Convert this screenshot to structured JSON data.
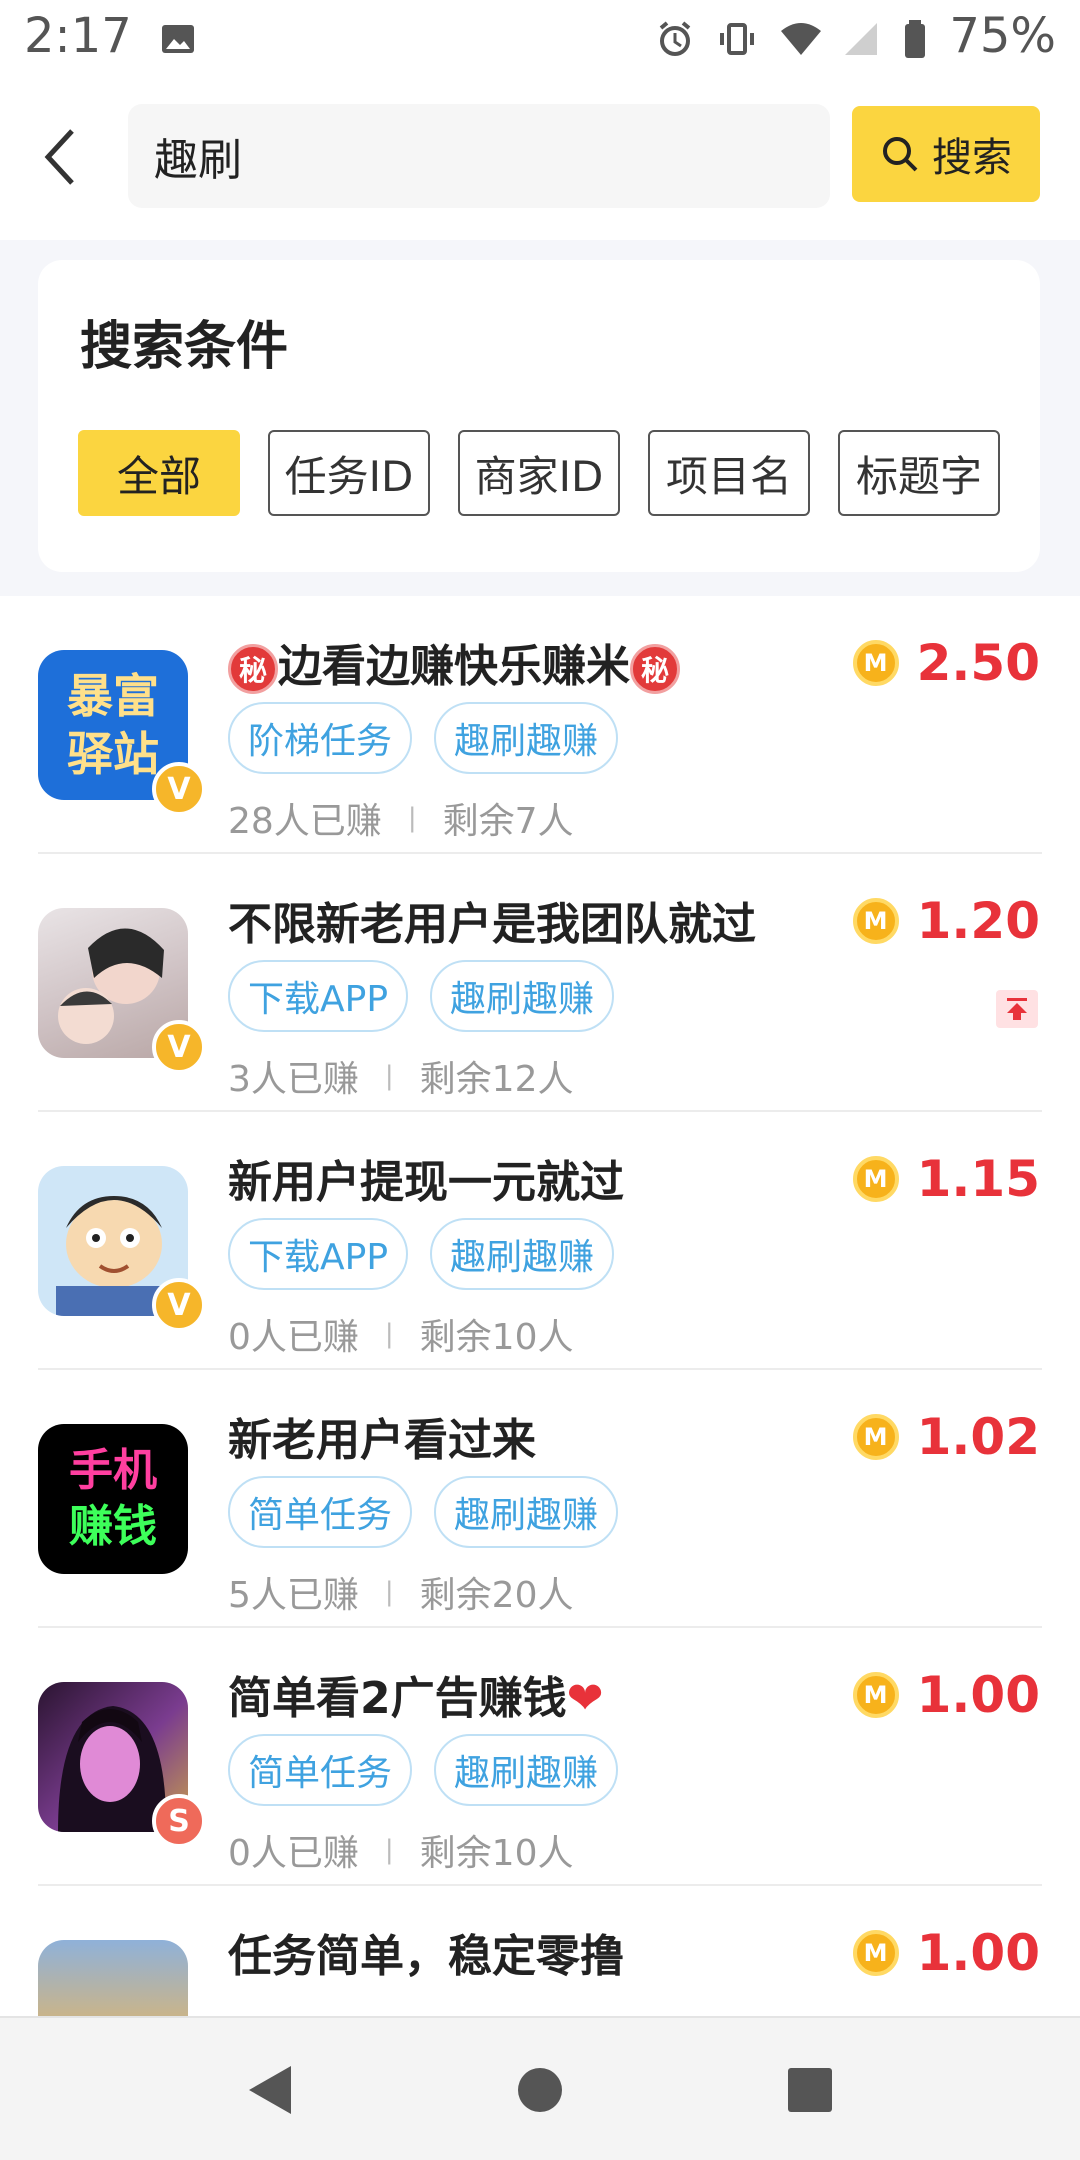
{
  "status_bar": {
    "time": "2:17",
    "battery": "75%",
    "icons": [
      "image-icon",
      "alarm-icon",
      "vibrate-icon",
      "wifi-icon",
      "signal-icon",
      "battery-icon"
    ]
  },
  "header": {
    "search_value": "趣刷",
    "search_button": "搜索"
  },
  "filter": {
    "title": "搜索条件",
    "chips": [
      "全部",
      "任务ID",
      "商家ID",
      "项目名",
      "标题字"
    ],
    "active_index": 0
  },
  "tasks": [
    {
      "title_main": "边看边赚快乐赚米",
      "secret_mark": "秘",
      "tags": [
        "阶梯任务",
        "趣刷趣赚"
      ],
      "earned": "28人已赚",
      "remaining": "剩余7人",
      "price": "2.50",
      "avatar_text_top": "暴富",
      "avatar_text_bottom": "驿站",
      "badge": "V",
      "badge_color": "#f6b62a"
    },
    {
      "title_main": "不限新老用户是我团队就过",
      "tags": [
        "下载APP",
        "趣刷趣赚"
      ],
      "earned": "3人已赚",
      "remaining": "剩余12人",
      "price": "1.20",
      "badge": "V",
      "badge_color": "#f6b62a",
      "pinned": true
    },
    {
      "title_main": "新用户提现一元就过",
      "tags": [
        "下载APP",
        "趣刷趣赚"
      ],
      "earned": "0人已赚",
      "remaining": "剩余10人",
      "price": "1.15",
      "badge": "V",
      "badge_color": "#f6b62a"
    },
    {
      "title_main": "新老用户看过来",
      "tags": [
        "简单任务",
        "趣刷趣赚"
      ],
      "earned": "5人已赚",
      "remaining": "剩余20人",
      "price": "1.02",
      "avatar_text_top": "手机",
      "avatar_text_bottom": "赚钱"
    },
    {
      "title_main": "简单看2广告赚钱",
      "tags": [
        "简单任务",
        "趣刷趣赚"
      ],
      "earned": "0人已赚",
      "remaining": "剩余10人",
      "price": "1.00",
      "badge": "S",
      "badge_color": "#ef6a5a"
    },
    {
      "title_main": "任务简单，稳定零撸",
      "tags": [],
      "price": "1.00"
    }
  ],
  "coin_symbol": "M",
  "colors": {
    "accent_yellow": "#fbd540",
    "price_red": "#e8323a",
    "tag_blue": "#3fa2e0"
  }
}
